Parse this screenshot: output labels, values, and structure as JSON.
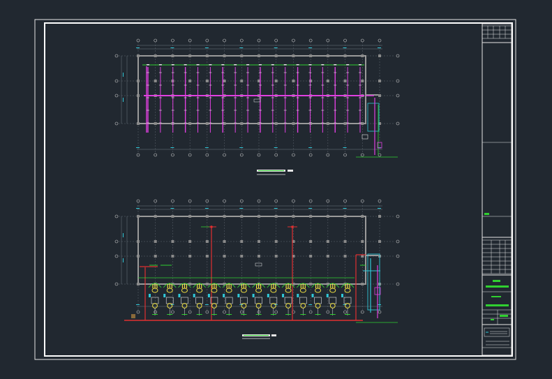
{
  "viewport": {
    "background": "#212830"
  },
  "drawing": {
    "colors": {
      "frame": "#e6e6e6",
      "wall": "#9a9a9a",
      "grid_line": "#6e7680",
      "column": "#8a8a8a",
      "sprinkler_pipe": "#e040e0",
      "drain_pipe": "#e03030",
      "fixture": "#f0e040",
      "fixture_outline": "#30d030",
      "cyan_riser": "#30c8d8",
      "dimension": "#30c8d8",
      "axis_bubble": "#cfcfcf",
      "title_bar_green": "#30d030"
    },
    "plans": [
      {
        "id": "upper-plan",
        "system": "sprinkler",
        "grid_columns": 15,
        "grid_rows": 4,
        "branch_count": 18
      },
      {
        "id": "lower-plan",
        "system": "plumbing",
        "grid_columns": 15,
        "grid_rows": 4,
        "fixture_count": 14
      }
    ],
    "title_block": {
      "sections": 6
    }
  }
}
